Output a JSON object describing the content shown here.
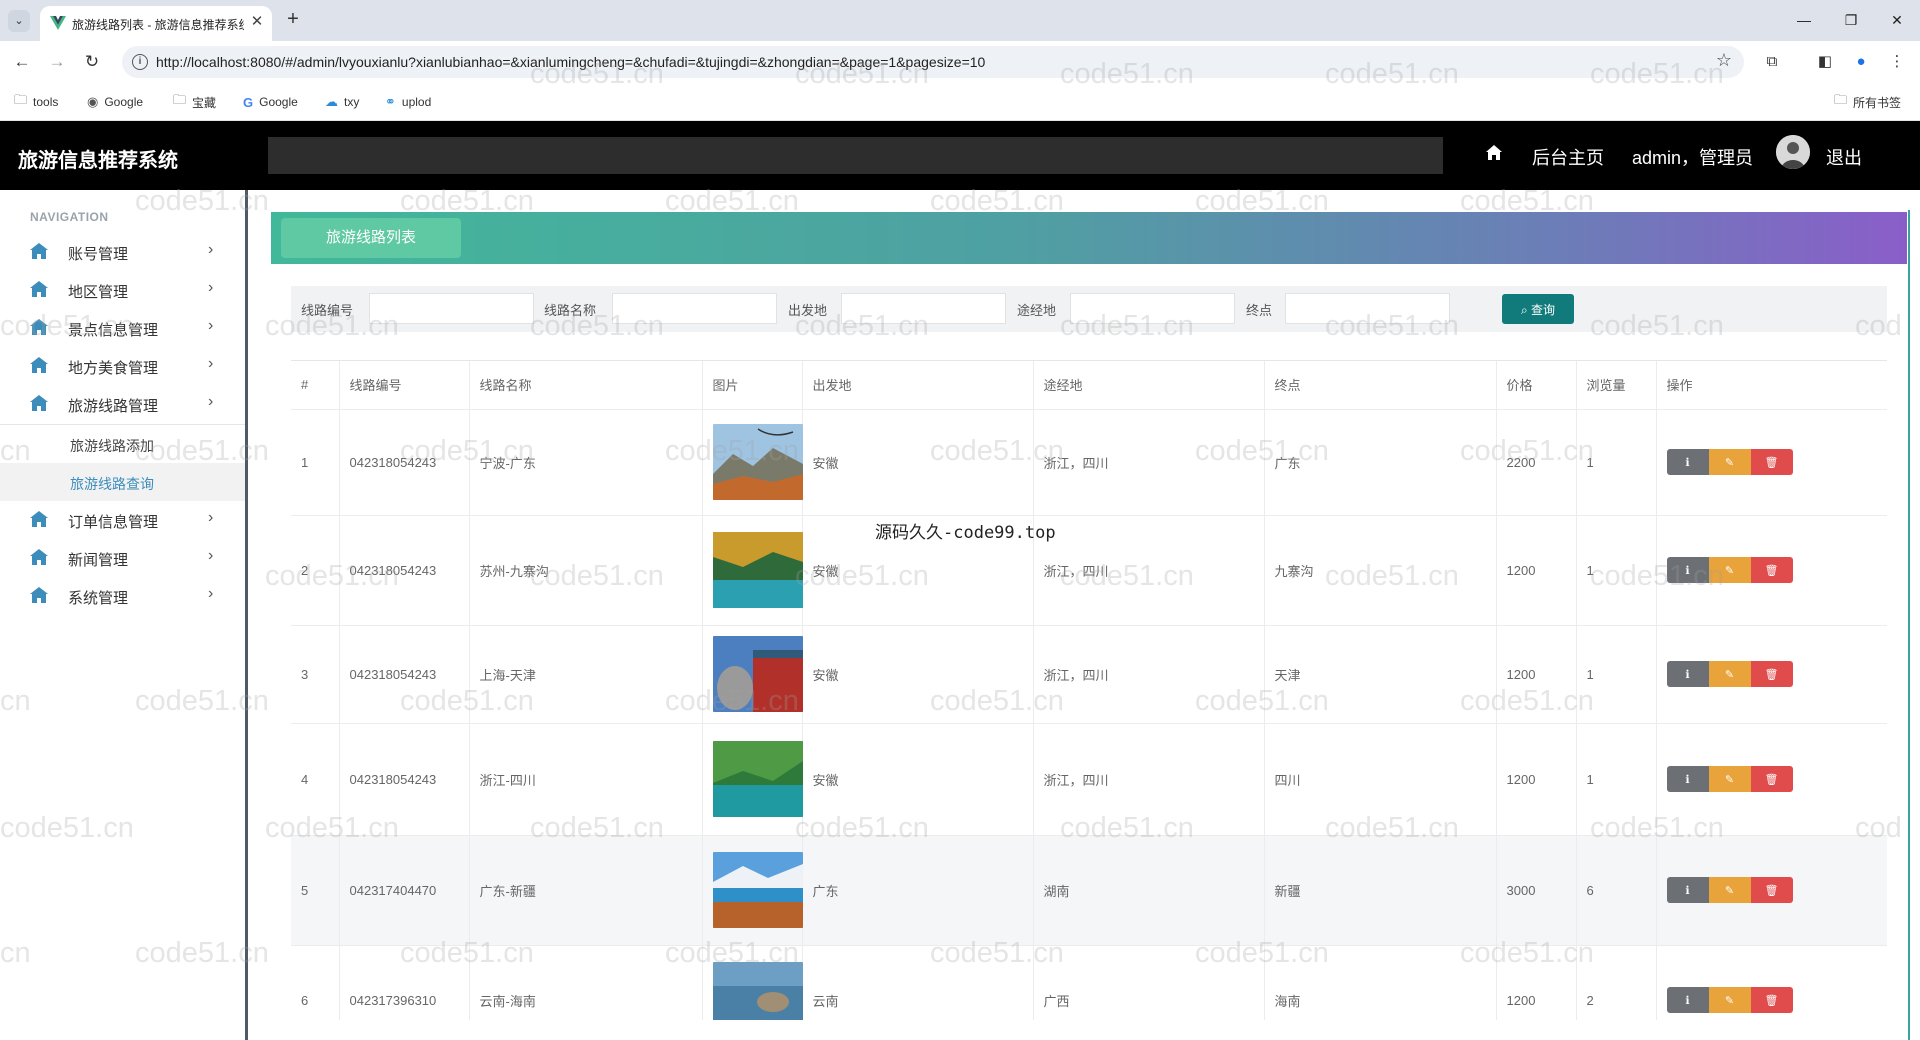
{
  "browser": {
    "tab_title": "旅游线路列表 - 旅游信息推荐系统",
    "tab_close": "✕",
    "new_tab": "+",
    "url": "http://localhost:8080/#/admin/lvyouxianlu?xianlubianhao=&xianlumingcheng=&chufadi=&tujingdi=&zhongdian=&page=1&pagesize=10",
    "bookmarks": [
      "tools",
      "Google",
      "宝藏",
      "Google",
      "txy",
      "uplod"
    ],
    "all_bookmarks": "所有书签"
  },
  "header": {
    "brand": "旅游信息推荐系统",
    "home": "后台主页",
    "user": "admin，管理员",
    "logout": "退出"
  },
  "sidebar": {
    "heading": "NAVIGATION",
    "items": [
      {
        "label": "账号管理"
      },
      {
        "label": "地区管理"
      },
      {
        "label": "景点信息管理"
      },
      {
        "label": "地方美食管理"
      },
      {
        "label": "旅游线路管理"
      },
      {
        "label": "订单信息管理"
      },
      {
        "label": "新闻管理"
      },
      {
        "label": "系统管理"
      }
    ],
    "sub_items": [
      {
        "label": "旅游线路添加"
      },
      {
        "label": "旅游线路查询"
      }
    ]
  },
  "page": {
    "banner_tab": "旅游线路列表",
    "search_button": "查询",
    "filters": [
      {
        "label": "线路编号",
        "value": ""
      },
      {
        "label": "线路名称",
        "value": ""
      },
      {
        "label": "出发地",
        "value": ""
      },
      {
        "label": "途经地",
        "value": ""
      },
      {
        "label": "终点",
        "value": ""
      }
    ]
  },
  "table": {
    "headers": [
      "#",
      "线路编号",
      "线路名称",
      "图片",
      "出发地",
      "途经地",
      "终点",
      "价格",
      "浏览量",
      "操作"
    ],
    "rows": [
      {
        "idx": "1",
        "code": "042318054243",
        "name": "宁波-广东",
        "from": "安徽",
        "via": "浙江，四川",
        "to": "广东",
        "price": "2200",
        "views": "1"
      },
      {
        "idx": "2",
        "code": "042318054243",
        "name": "苏州-九寨沟",
        "from": "安徽",
        "via": "浙江，四川",
        "to": "九寨沟",
        "price": "1200",
        "views": "1"
      },
      {
        "idx": "3",
        "code": "042318054243",
        "name": "上海-天津",
        "from": "安徽",
        "via": "浙江，四川",
        "to": "天津",
        "price": "1200",
        "views": "1"
      },
      {
        "idx": "4",
        "code": "042318054243",
        "name": "浙江-四川",
        "from": "安徽",
        "via": "浙江，四川",
        "to": "四川",
        "price": "1200",
        "views": "1"
      },
      {
        "idx": "5",
        "code": "042317404470",
        "name": "广东-新疆",
        "from": "广东",
        "via": "湖南",
        "to": "新疆",
        "price": "3000",
        "views": "6"
      },
      {
        "idx": "6",
        "code": "042317396310",
        "name": "云南-海南",
        "from": "云南",
        "via": "广西",
        "to": "海南",
        "price": "1200",
        "views": "2"
      }
    ]
  },
  "overlay": "源码久久-code99.top",
  "watermark": "code51.cn",
  "watermark_partial": "cod",
  "watermark_tail": "cn",
  "colors": {
    "header_bg": "#000000",
    "search_btn": "#117a7a",
    "btn_view": "#6c6f73",
    "btn_edit": "#e8a33a",
    "btn_delete": "#e04b4b"
  }
}
